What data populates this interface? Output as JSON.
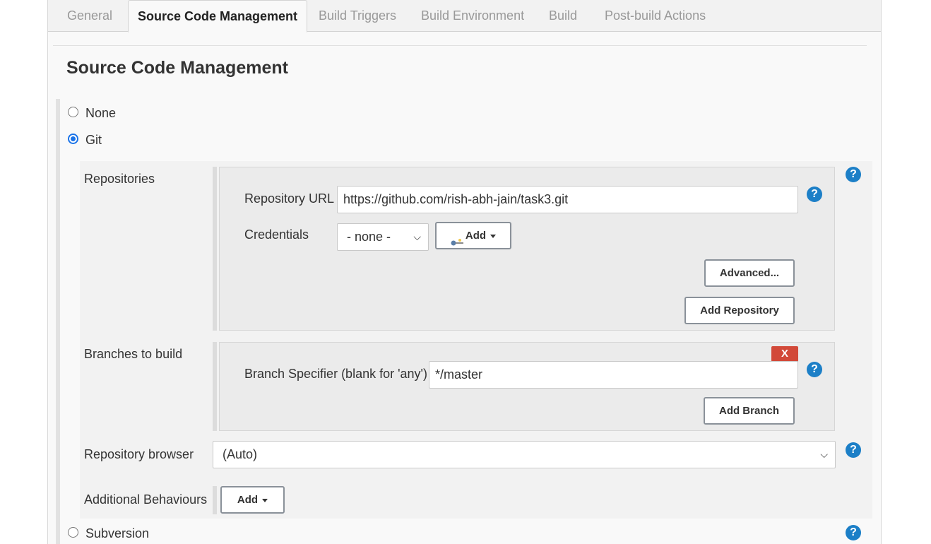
{
  "tabs": [
    {
      "label": "General",
      "active": false
    },
    {
      "label": "Source Code Management",
      "active": true
    },
    {
      "label": "Build Triggers",
      "active": false
    },
    {
      "label": "Build Environment",
      "active": false
    },
    {
      "label": "Build",
      "active": false
    },
    {
      "label": "Post-build Actions",
      "active": false
    }
  ],
  "section_title": "Source Code Management",
  "scm_options": [
    {
      "label": "None",
      "selected": false
    },
    {
      "label": "Git",
      "selected": true
    },
    {
      "label": "Subversion",
      "selected": false
    }
  ],
  "repositories": {
    "label": "Repositories",
    "url_label": "Repository URL",
    "url_value": "https://github.com/rish-abh-jain/task3.git",
    "credentials_label": "Credentials",
    "credentials_value": "- none -",
    "add_label": "Add",
    "advanced_label": "Advanced...",
    "add_repository_label": "Add Repository"
  },
  "branches": {
    "label": "Branches to build",
    "delete_label": "X",
    "specifier_label": "Branch Specifier (blank for 'any')",
    "specifier_value": "*/master",
    "add_branch_label": "Add Branch"
  },
  "repo_browser": {
    "label": "Repository browser",
    "value": "(Auto)"
  },
  "additional": {
    "label": "Additional Behaviours",
    "add_label": "Add"
  },
  "help_glyph": "?",
  "colors": {
    "help": "#1c7fc7",
    "delete": "#d24939",
    "radio_selected": "#1a73e8"
  }
}
